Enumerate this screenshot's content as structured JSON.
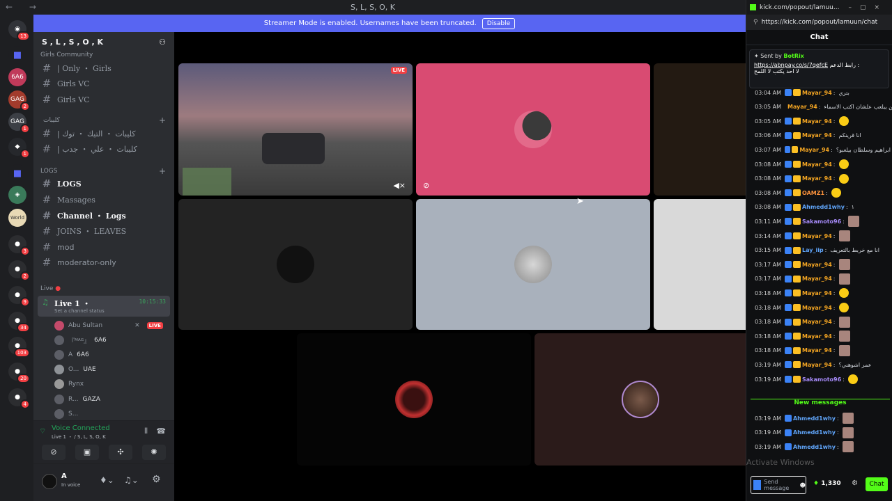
{
  "window": {
    "title": "S, L, S, O, K"
  },
  "banner": {
    "text": "Streamer Mode is enabled. Usernames have been truncated.",
    "button": "Disable"
  },
  "server": {
    "name": "S , L , S , O , K"
  },
  "rail_badges": [
    "13",
    "2",
    "1",
    "1",
    "3",
    "2",
    "9",
    "34",
    "103",
    "20",
    "4"
  ],
  "sidebar": {
    "category1": "Girls Community",
    "ch1": "| Only ・ Girls",
    "ch2": "Girls VC",
    "ch3": "Girls VC",
    "category2": "كليبات",
    "ch4": "| كليبات ・ التيك ・ توك",
    "ch5": "| كليبات ・ علي ・ جدب",
    "category3": "LOGS",
    "ch6": "LOGS",
    "ch7": "Massages",
    "ch8": "Channel ・ Logs",
    "ch9": "JOINS ・ LEAVES",
    "ch10": "mod",
    "ch11": "moderator-only",
    "category4": "Live",
    "live_channel": "Live 1 ・",
    "live_timer": "10:15:33",
    "channel_status": "Set a channel status",
    "users": [
      {
        "name": "Abu Sultan",
        "tag": "",
        "live": "LIVE"
      },
      {
        "name": "『ᴹᴬᴳ』",
        "tag": "6A6",
        "live": ""
      },
      {
        "name": "A",
        "tag": "6A6",
        "live": ""
      },
      {
        "name": "O...",
        "tag": "UAE",
        "live": ""
      },
      {
        "name": "Rynx",
        "tag": "",
        "live": ""
      },
      {
        "name": "R...",
        "tag": "GAZA",
        "live": ""
      },
      {
        "name": "S...",
        "tag": "",
        "live": ""
      }
    ]
  },
  "voice": {
    "status": "Voice Connected",
    "location": "Live 1 ・ / S, L, S, O, K"
  },
  "user": {
    "name": "A",
    "status": "In voice"
  },
  "stream": {
    "live_label": "LIVE"
  },
  "browser": {
    "tab": "kick.com/popout/lamuu...",
    "url": "https://kick.com/popout/lamuun/chat"
  },
  "chat": {
    "header": "Chat",
    "pinned_by": "Sent by",
    "pinned_user": "BotRix",
    "pinned_link": "https://abnpay.co/s/7qefcE",
    "pinned_text": "رابط الدعم :",
    "pinned_line2": "لا احد يكتب لا اللمح",
    "messages": [
      {
        "time": "03:04 AM",
        "user": "Mayar_94",
        "text": "بتري",
        "color": "#f5a623",
        "kind": "text"
      },
      {
        "time": "03:05 AM",
        "user": "Mayar_94",
        "text": "قولولي مين يبلعب علشان اكتب الاسماء",
        "color": "#f5a623",
        "kind": "text"
      },
      {
        "time": "03:05 AM",
        "user": "Mayar_94",
        "text": "",
        "color": "#f5a623",
        "kind": "emote"
      },
      {
        "time": "03:06 AM",
        "user": "Mayar_94",
        "text": "انا قرينكم",
        "color": "#f5a623",
        "kind": "text"
      },
      {
        "time": "03:07 AM",
        "user": "Mayar_94",
        "text": "ابراهيم وسلطان بيلعبو؟",
        "color": "#f5a623",
        "kind": "text"
      },
      {
        "time": "03:08 AM",
        "user": "Mayar_94",
        "text": "",
        "color": "#f5a623",
        "kind": "emote"
      },
      {
        "time": "03:08 AM",
        "user": "Mayar_94",
        "text": "",
        "color": "#f5a623",
        "kind": "emote"
      },
      {
        "time": "03:08 AM",
        "user": "OAMZ1",
        "text": "",
        "color": "#fb923c",
        "kind": "emote"
      },
      {
        "time": "03:08 AM",
        "user": "Ahmedd1why",
        "text": "١",
        "color": "#60a5fa",
        "kind": "text"
      },
      {
        "time": "03:11 AM",
        "user": "Sakamoto96",
        "text": "",
        "color": "#a78bfa",
        "kind": "image"
      },
      {
        "time": "03:14 AM",
        "user": "Mayar_94",
        "text": "",
        "color": "#f5a623",
        "kind": "image"
      },
      {
        "time": "03:15 AM",
        "user": "Lay_iip",
        "text": "انا مع خربط بالتعريف",
        "color": "#60a5fa",
        "kind": "text"
      },
      {
        "time": "03:17 AM",
        "user": "Mayar_94",
        "text": "",
        "color": "#f5a623",
        "kind": "image"
      },
      {
        "time": "03:17 AM",
        "user": "Mayar_94",
        "text": "",
        "color": "#f5a623",
        "kind": "image"
      },
      {
        "time": "03:18 AM",
        "user": "Mayar_94",
        "text": "",
        "color": "#f5a623",
        "kind": "emote"
      },
      {
        "time": "03:18 AM",
        "user": "Mayar_94",
        "text": "",
        "color": "#f5a623",
        "kind": "emote"
      },
      {
        "time": "03:18 AM",
        "user": "Mayar_94",
        "text": "",
        "color": "#f5a623",
        "kind": "image"
      },
      {
        "time": "03:18 AM",
        "user": "Mayar_94",
        "text": "",
        "color": "#f5a623",
        "kind": "image"
      },
      {
        "time": "03:18 AM",
        "user": "Mayar_94",
        "text": "",
        "color": "#f5a623",
        "kind": "image"
      },
      {
        "time": "03:19 AM",
        "user": "Mayar_94",
        "text": "عمر اشوهني؟",
        "color": "#f5a623",
        "kind": "text"
      },
      {
        "time": "03:19 AM",
        "user": "Sakamoto96",
        "text": "",
        "color": "#a78bfa",
        "kind": "emote"
      }
    ],
    "new_label": "New messages",
    "new_messages": [
      {
        "time": "03:19 AM",
        "user": "Ahmedd1why",
        "color": "#60a5fa"
      },
      {
        "time": "03:19 AM",
        "user": "Ahmedd1why",
        "color": "#60a5fa"
      },
      {
        "time": "03:19 AM",
        "user": "Ahmedd1why",
        "color": "#60a5fa"
      }
    ],
    "input_placeholder": "Send message",
    "viewers": "1,330",
    "send_button": "Chat",
    "watermark": "Activate Windows"
  }
}
